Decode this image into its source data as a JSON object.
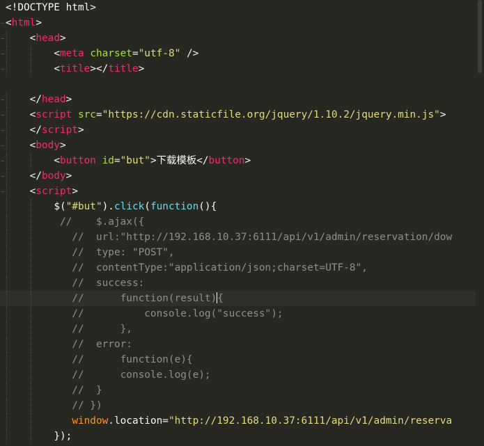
{
  "editor": {
    "language": "html",
    "theme": "monokai-dark",
    "current_line": 20,
    "lines": [
      {
        "indent": 0,
        "parts": [
          [
            "p",
            "<!DOCTYPE html>"
          ]
        ]
      },
      {
        "indent": 0,
        "parts": [
          [
            "p",
            "<"
          ],
          [
            "t",
            "html"
          ],
          [
            "p",
            ">"
          ]
        ]
      },
      {
        "indent": 1,
        "parts": [
          [
            "p",
            "<"
          ],
          [
            "t",
            "head"
          ],
          [
            "p",
            ">"
          ]
        ]
      },
      {
        "indent": 2,
        "parts": [
          [
            "p",
            "<"
          ],
          [
            "t",
            "meta"
          ],
          [
            "p",
            " "
          ],
          [
            "a",
            "charset"
          ],
          [
            "p",
            "="
          ],
          [
            "s",
            "\"utf-8\""
          ],
          [
            "p",
            " />"
          ]
        ]
      },
      {
        "indent": 2,
        "parts": [
          [
            "p",
            "<"
          ],
          [
            "t",
            "title"
          ],
          [
            "p",
            "></"
          ],
          [
            "t",
            "title"
          ],
          [
            "p",
            ">"
          ]
        ]
      },
      {
        "indent": 0,
        "parts": []
      },
      {
        "indent": 1,
        "parts": [
          [
            "p",
            "</"
          ],
          [
            "t",
            "head"
          ],
          [
            "p",
            ">"
          ]
        ]
      },
      {
        "indent": 1,
        "parts": [
          [
            "p",
            "<"
          ],
          [
            "t",
            "script"
          ],
          [
            "p",
            " "
          ],
          [
            "a",
            "src"
          ],
          [
            "p",
            "="
          ],
          [
            "s",
            "\"https://cdn.staticfile.org/jquery/1.10.2/jquery.min.js\""
          ],
          [
            "p",
            ">"
          ]
        ]
      },
      {
        "indent": 1,
        "parts": [
          [
            "p",
            "</"
          ],
          [
            "t",
            "script"
          ],
          [
            "p",
            ">"
          ]
        ]
      },
      {
        "indent": 1,
        "parts": [
          [
            "p",
            "<"
          ],
          [
            "t",
            "body"
          ],
          [
            "p",
            ">"
          ]
        ]
      },
      {
        "indent": 2,
        "parts": [
          [
            "p",
            "<"
          ],
          [
            "t",
            "button"
          ],
          [
            "p",
            " "
          ],
          [
            "a",
            "id"
          ],
          [
            "p",
            "="
          ],
          [
            "s",
            "\"but\""
          ],
          [
            "p",
            ">下载模板</"
          ],
          [
            "t",
            "button"
          ],
          [
            "p",
            ">"
          ]
        ]
      },
      {
        "indent": 1,
        "parts": [
          [
            "p",
            "</"
          ],
          [
            "t",
            "body"
          ],
          [
            "p",
            ">"
          ]
        ]
      },
      {
        "indent": 1,
        "parts": [
          [
            "p",
            "<"
          ],
          [
            "t",
            "script"
          ],
          [
            "p",
            ">"
          ]
        ]
      },
      {
        "indent": 2,
        "parts": [
          [
            "p",
            "$("
          ],
          [
            "s",
            "\"#but\""
          ],
          [
            "p",
            ")."
          ],
          [
            "f",
            "click"
          ],
          [
            "p",
            "("
          ],
          [
            "f",
            "function"
          ],
          [
            "p",
            "(){"
          ]
        ]
      },
      {
        "indent": 2,
        "parts": [
          [
            "c",
            " //    $.ajax({"
          ]
        ]
      },
      {
        "indent": 2,
        "parts": [
          [
            "c",
            "   //  url:\"http://192.168.10.37:6111/api/v1/admin/reservation/dow"
          ]
        ]
      },
      {
        "indent": 2,
        "parts": [
          [
            "c",
            "   //  type: \"POST\","
          ]
        ]
      },
      {
        "indent": 2,
        "parts": [
          [
            "c",
            "   //  contentType:\"application/json;charset=UTF-8\","
          ]
        ]
      },
      {
        "indent": 2,
        "parts": [
          [
            "c",
            "   //  success:"
          ]
        ]
      },
      {
        "indent": 2,
        "parts": [
          [
            "c",
            "   //      function(result)"
          ],
          [
            "cursor",
            ""
          ],
          [
            "c",
            "{"
          ]
        ]
      },
      {
        "indent": 2,
        "parts": [
          [
            "c",
            "   //          console.log(\"success\");"
          ]
        ]
      },
      {
        "indent": 2,
        "parts": [
          [
            "c",
            "   //      },"
          ]
        ]
      },
      {
        "indent": 2,
        "parts": [
          [
            "c",
            "   //  error:"
          ]
        ]
      },
      {
        "indent": 2,
        "parts": [
          [
            "c",
            "   //      function(e){"
          ]
        ]
      },
      {
        "indent": 2,
        "parts": [
          [
            "c",
            "   //      console.log(e);"
          ]
        ]
      },
      {
        "indent": 2,
        "parts": [
          [
            "c",
            "   //  }"
          ]
        ]
      },
      {
        "indent": 2,
        "parts": [
          [
            "c",
            "   // })"
          ]
        ]
      },
      {
        "indent": 2,
        "parts": [
          [
            "p",
            "   "
          ],
          [
            "w",
            "window"
          ],
          [
            "p",
            "."
          ],
          [
            "p",
            "location"
          ],
          [
            "p",
            "="
          ],
          [
            "s",
            "\"http://192.168.10.37:6111/api/v1/admin/reserva"
          ]
        ]
      },
      {
        "indent": 2,
        "parts": [
          [
            "p",
            "});"
          ]
        ]
      }
    ]
  }
}
